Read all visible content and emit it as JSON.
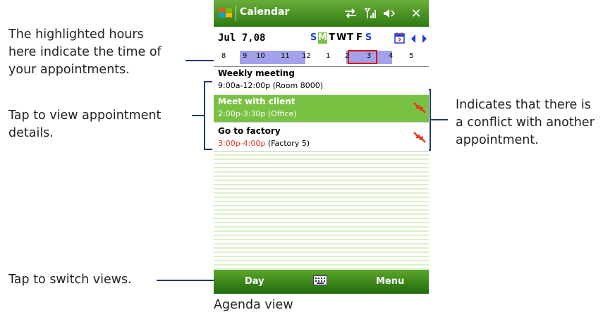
{
  "annotations": {
    "hours": "The highlighted hours\nhere indicate the time of\nyour appointments.",
    "details": "Tap to view appointment\ndetails.",
    "conflict": "Indicates that there is\na conflict with another\nappointment.",
    "switch": "Tap to switch views."
  },
  "window": {
    "title": "Calendar",
    "start_icon": "windows-start-icon"
  },
  "status_icons": [
    "connectivity-icon",
    "signal-icon",
    "volume-icon",
    "close-icon"
  ],
  "date_bar": {
    "date": "Jul  7,08",
    "week_days": [
      {
        "label": "S",
        "color": "#1a3fd6"
      },
      {
        "label": "M",
        "color": "#ffffff",
        "selected": true
      },
      {
        "label": "T",
        "color": "#000000"
      },
      {
        "label": "W",
        "color": "#000000"
      },
      {
        "label": "T",
        "color": "#000000"
      },
      {
        "label": "F",
        "color": "#000000"
      },
      {
        "label": "S",
        "color": "#1a3fd6"
      }
    ],
    "icons": [
      "calendar-jump-icon",
      "prev-week-icon",
      "next-week-icon"
    ]
  },
  "hour_bar": {
    "hours": [
      "8",
      "9",
      "10",
      "11",
      "12",
      "1",
      "2",
      "3",
      "4",
      "5"
    ]
  },
  "appointments": [
    {
      "title": "Weekly meeting",
      "time": "9:00a-12:00p",
      "location": "(Room 8000)",
      "time_color": "#000000",
      "selected": false,
      "conflict": false
    },
    {
      "title": "Meet with client",
      "time": "2:00p-3:30p",
      "location": "(Office)",
      "time_color": "#ffffff",
      "selected": true,
      "conflict": true
    },
    {
      "title": "Go to factory",
      "time": "3:00p-4:00p",
      "location": "(Factory 5)",
      "time_color": "#e8392a",
      "selected": false,
      "conflict": true
    }
  ],
  "softkeys": {
    "left": "Day",
    "right": "Menu",
    "center_icon": "keyboard-icon"
  },
  "caption": "Agenda view",
  "colors": {
    "title_green": "#3d8a1c",
    "selected_green": "#79c142",
    "busy_purple": "#a2a2ea",
    "conflict_red": "#e8392a",
    "weekend_blue": "#1a3fd6",
    "callout_line": "#1f3b70"
  }
}
